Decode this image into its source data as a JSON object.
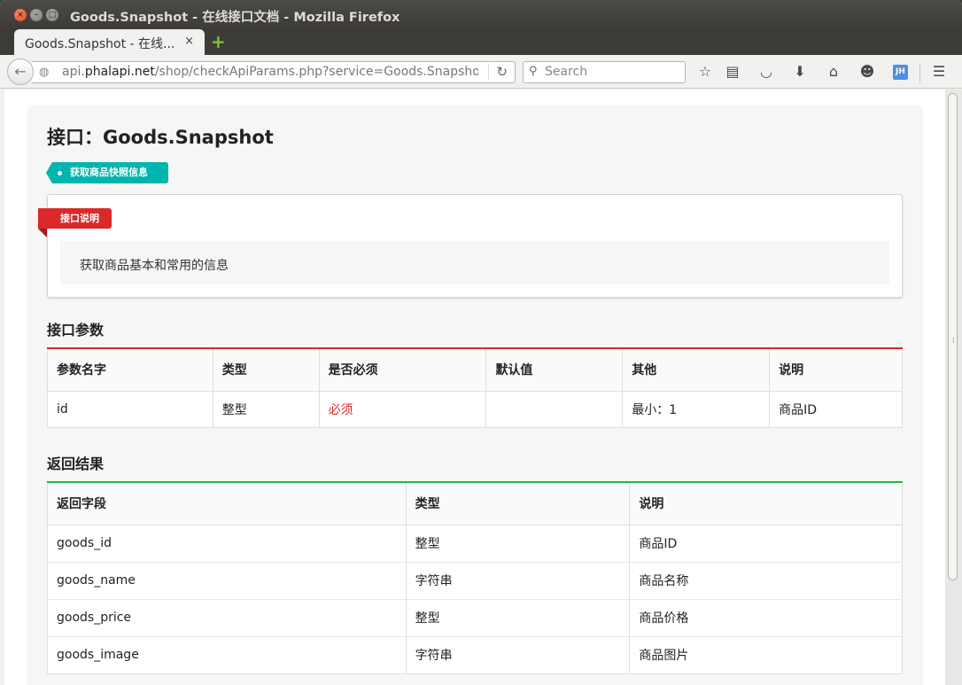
{
  "window": {
    "title": "Goods.Snapshot - 在线接口文档 - Mozilla Firefox"
  },
  "tab": {
    "title": "Goods.Snapshot - 在线...",
    "close": "×",
    "new": "+"
  },
  "navbar": {
    "url_prefix": "api.",
    "url_host": "phalapi.net",
    "url_rest": "/shop/checkApiParams.php?service=Goods.Snapsho",
    "search_placeholder": "Search"
  },
  "page": {
    "title": "接口：Goods.Snapshot",
    "summary_tag": "获取商品快照信息",
    "ribbon_label": "接口说明",
    "description": "获取商品基本和常用的信息",
    "params_heading": "接口参数",
    "results_heading": "返回结果"
  },
  "params_table": {
    "headers": [
      "参数名字",
      "类型",
      "是否必须",
      "默认值",
      "其他",
      "说明"
    ],
    "rows": [
      [
        "id",
        "整型",
        "必须",
        "",
        "最小：1",
        "商品ID"
      ]
    ]
  },
  "results_table": {
    "headers": [
      "返回字段",
      "类型",
      "说明"
    ],
    "rows": [
      [
        "goods_id",
        "整型",
        "商品ID"
      ],
      [
        "goods_name",
        "字符串",
        "商品名称"
      ],
      [
        "goods_price",
        "整型",
        "商品价格"
      ],
      [
        "goods_image",
        "字符串",
        "商品图片"
      ]
    ]
  },
  "colors": {
    "accent_red": "#db2828",
    "accent_teal": "#00b5ad",
    "accent_green": "#21ba45"
  }
}
